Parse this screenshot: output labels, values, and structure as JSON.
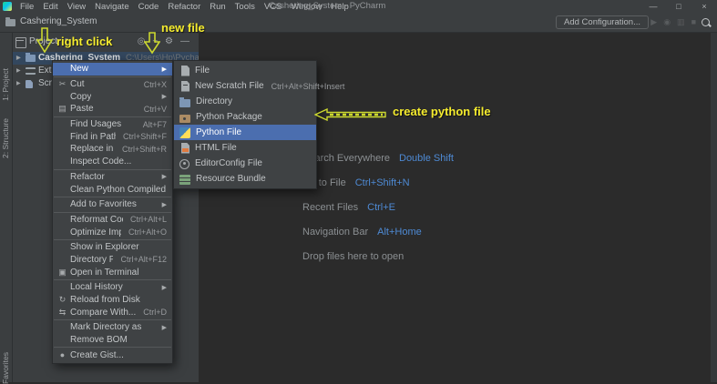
{
  "window": {
    "title": "Cashering_System - PyCharm",
    "menu_items": [
      "File",
      "Edit",
      "View",
      "Navigate",
      "Code",
      "Refactor",
      "Run",
      "Tools",
      "VCS",
      "Window",
      "Help"
    ],
    "controls": {
      "minimize": "—",
      "maximize": "□",
      "close": "×"
    }
  },
  "toolbar": {
    "project_crumb": "Cashering_System",
    "add_configuration_label": "Add Configuration...",
    "run_icons": [
      "run-icon",
      "debug-icon",
      "coverage-icon",
      "stop-icon"
    ],
    "search_icon": "search-icon"
  },
  "tool_window_bar": {
    "top_items": [
      {
        "label": "1: Project",
        "icon": "project-toolwindow-icon"
      },
      {
        "label": "2: Structure",
        "icon": "structure-toolwindow-icon"
      }
    ],
    "bottom_items": [
      {
        "label": "Favorites",
        "icon": "favorites-toolwindow-icon"
      }
    ]
  },
  "project_panel": {
    "header": {
      "title": "Project",
      "caret": "▾",
      "icons": [
        "locate-icon",
        "collapse-all-icon",
        "settings-icon",
        "hide-icon"
      ]
    },
    "tree": [
      {
        "icon": "folder-icon",
        "label": "Cashering_System",
        "path": "C:\\Users\\Hp\\PycharmProjects\\Cashering_System",
        "selected": true
      },
      {
        "icon": "libraries-icon",
        "label": "External Libraries",
        "selected": false
      },
      {
        "icon": "scratches-icon",
        "label": "Scratches and Consoles",
        "selected": false
      }
    ]
  },
  "context_menu": {
    "items": [
      {
        "label": "New",
        "selected": true,
        "arrow": true
      },
      {
        "sep": true
      },
      {
        "icon": "cut-icon",
        "label": "Cut",
        "shortcut": "Ctrl+X"
      },
      {
        "label": "Copy",
        "arrow": true
      },
      {
        "icon": "paste-icon",
        "label": "Paste",
        "shortcut": "Ctrl+V"
      },
      {
        "sep": true
      },
      {
        "label": "Find Usages",
        "shortcut": "Alt+F7"
      },
      {
        "label": "Find in Path...",
        "shortcut": "Ctrl+Shift+F"
      },
      {
        "label": "Replace in Path...",
        "shortcut": "Ctrl+Shift+R"
      },
      {
        "label": "Inspect Code..."
      },
      {
        "sep": true
      },
      {
        "label": "Refactor",
        "arrow": true
      },
      {
        "label": "Clean Python Compiled Files"
      },
      {
        "sep": true
      },
      {
        "label": "Add to Favorites",
        "arrow": true
      },
      {
        "sep": true
      },
      {
        "label": "Reformat Code",
        "shortcut": "Ctrl+Alt+L"
      },
      {
        "label": "Optimize Imports",
        "shortcut": "Ctrl+Alt+O"
      },
      {
        "sep": true
      },
      {
        "label": "Show in Explorer"
      },
      {
        "label": "Directory Path",
        "shortcut": "Ctrl+Alt+F12"
      },
      {
        "icon": "terminal-icon",
        "label": "Open in Terminal"
      },
      {
        "sep": true
      },
      {
        "label": "Local History",
        "arrow": true
      },
      {
        "icon": "reload-icon",
        "label": "Reload from Disk"
      },
      {
        "icon": "compare-icon",
        "label": "Compare With...",
        "shortcut": "Ctrl+D"
      },
      {
        "sep": true
      },
      {
        "label": "Mark Directory as",
        "arrow": true
      },
      {
        "label": "Remove BOM"
      },
      {
        "sep": true
      },
      {
        "icon": "github-icon",
        "label": "Create Gist..."
      }
    ]
  },
  "new_submenu": {
    "items": [
      {
        "icon": "file-icon",
        "label": "File"
      },
      {
        "icon": "scratch-file-icon",
        "label": "New Scratch File",
        "shortcut": "Ctrl+Alt+Shift+Insert"
      },
      {
        "icon": "directory-icon",
        "label": "Directory"
      },
      {
        "icon": "python-package-icon",
        "label": "Python Package"
      },
      {
        "icon": "python-file-icon",
        "label": "Python File",
        "selected": true
      },
      {
        "icon": "html-file-icon",
        "label": "HTML File"
      },
      {
        "icon": "editorconfig-icon",
        "label": "EditorConfig File"
      },
      {
        "icon": "resource-bundle-icon",
        "label": "Resource Bundle"
      }
    ]
  },
  "editor": {
    "shortcut_hints": [
      {
        "label": "Search Everywhere",
        "shortcut": "Double Shift"
      },
      {
        "label": "Go to File",
        "shortcut": "Ctrl+Shift+N"
      },
      {
        "label": "Recent Files",
        "shortcut": "Ctrl+E"
      },
      {
        "label": "Navigation Bar",
        "shortcut": "Alt+Home"
      }
    ],
    "drop_hint": "Drop files here to open"
  },
  "annotations": {
    "right_click_label": "right click",
    "new_file_label": "new file",
    "create_python_file_label": "create python file",
    "text_color": "#f5ec2e",
    "arrow_color": "#ccd82f"
  },
  "colors": {
    "selection_blue": "#4b6eaf",
    "tree_selection": "#33475e",
    "panel_bg": "#3b3e40",
    "editor_bg": "#2b2b2b",
    "shortcut_blue": "#4e8ad4"
  }
}
